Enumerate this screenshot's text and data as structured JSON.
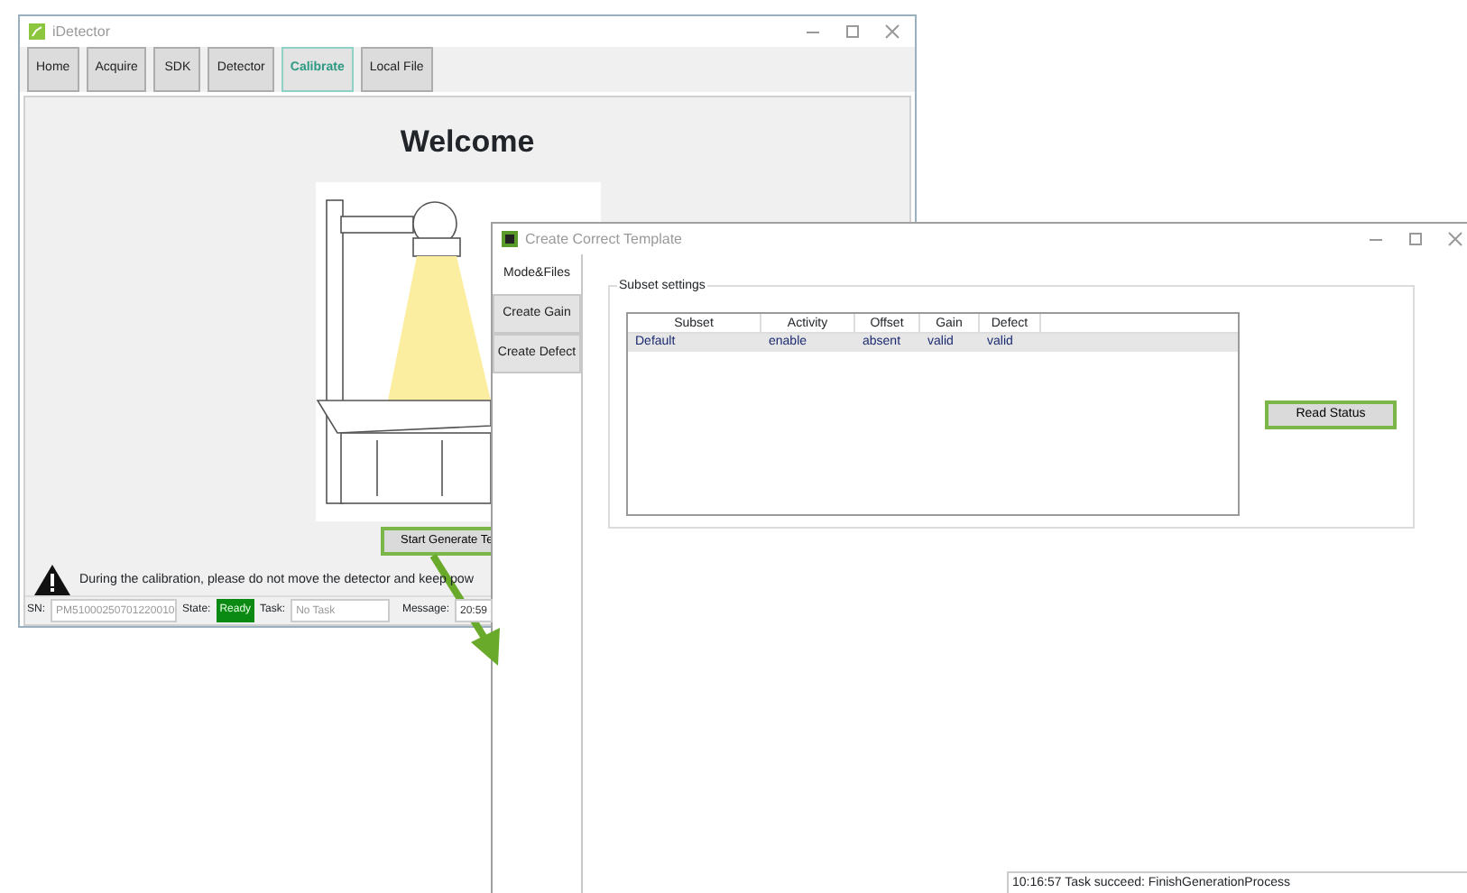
{
  "main_window": {
    "title": "iDetector",
    "toolbar": [
      {
        "label": "Home",
        "selected": false
      },
      {
        "label": "Acquire",
        "selected": false
      },
      {
        "label": "SDK",
        "selected": false
      },
      {
        "label": "Detector",
        "selected": false
      },
      {
        "label": "Calibrate",
        "selected": true
      },
      {
        "label": "Local File",
        "selected": false
      }
    ],
    "heading": "Welcome",
    "start_button": {
      "label": "Start Generate Te",
      "highlighted": true
    },
    "warning": "During the calibration, please do not move the detector and keep pow",
    "status_bar": {
      "sn_label": "SN:",
      "sn_value": "PM51000250701220010",
      "state_label": "State:",
      "state_value": "Ready",
      "task_label": "Task:",
      "task_value": "No Task",
      "message_label": "Message:",
      "message_value": "20:59"
    }
  },
  "template_window": {
    "title": "Create Correct Template",
    "tabs": [
      {
        "label": "Mode&Files",
        "selected": true
      },
      {
        "label": "Create Gain",
        "selected": false
      },
      {
        "label": "Create Defect",
        "selected": false
      }
    ],
    "group_title": "Subset settings",
    "table": {
      "columns": [
        "Subset",
        "Activity",
        "Offset",
        "Gain",
        "Defect"
      ],
      "rows": [
        {
          "cells": [
            "Default",
            "enable",
            "absent",
            "valid",
            "valid"
          ],
          "selected": true
        }
      ]
    },
    "read_status_button": {
      "label": "Read Status",
      "highlighted": true
    },
    "log": "10:16:57 Task succeed: FinishGenerationProcess"
  }
}
